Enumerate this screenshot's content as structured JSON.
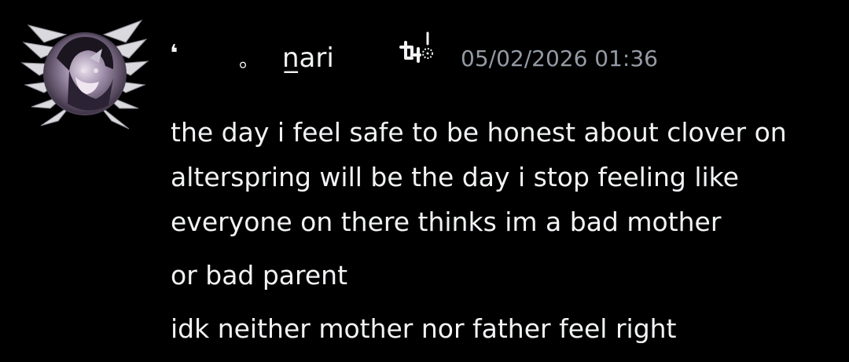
{
  "message": {
    "author": {
      "prefix_glyph": "❛",
      "spacer_glyph": "。",
      "username": "n̲ari",
      "badge_icon": "tag-badge-icon"
    },
    "timestamp": "05/02/2026 01:36",
    "paragraphs": [
      {
        "lines": [
          "the day i feel safe to be honest about clover on",
          "alterspring will be the day i stop feeling like",
          "everyone on there thinks im a bad mother"
        ]
      },
      {
        "lines": [
          "or bad parent"
        ]
      },
      {
        "lines": [
          "idk neither mother nor father feel right"
        ]
      }
    ]
  },
  "colors": {
    "background": "#000000",
    "text": "#f2f3f5",
    "timestamp": "#949ba4"
  }
}
